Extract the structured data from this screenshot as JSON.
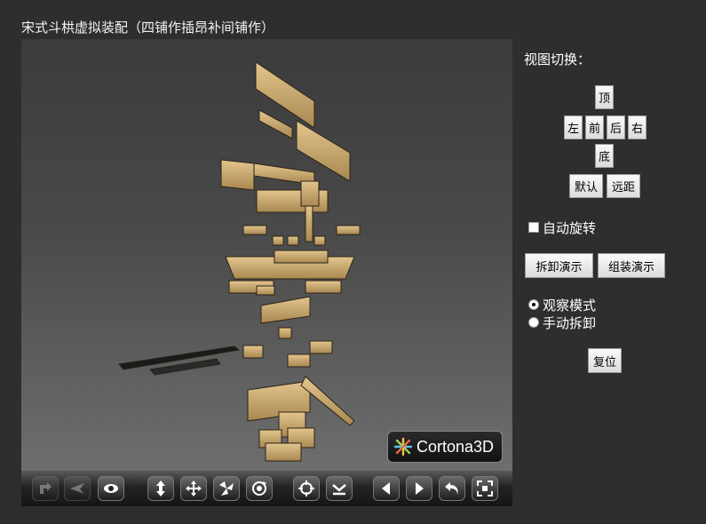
{
  "title": "宋式斗栱虚拟装配（四铺作插昂补间铺作）",
  "viewport": {
    "logo_text": "Cortona3D",
    "toolbar": [
      {
        "name": "plan-icon"
      },
      {
        "name": "fly-icon"
      },
      {
        "name": "eye-icon"
      },
      {
        "name": "vertical-move-icon"
      },
      {
        "name": "pan-icon"
      },
      {
        "name": "rotate-icon"
      },
      {
        "name": "orbit-icon"
      },
      {
        "name": "target-icon"
      },
      {
        "name": "align-icon"
      },
      {
        "name": "prev-icon"
      },
      {
        "name": "next-icon"
      },
      {
        "name": "undo-icon"
      },
      {
        "name": "fit-icon"
      }
    ]
  },
  "panel": {
    "view_switch_label": "视图切换：",
    "views": {
      "top": "顶",
      "left": "左",
      "front": "前",
      "back": "后",
      "right": "右",
      "bottom": "底",
      "default": "默认",
      "far": "远距"
    },
    "auto_rotate_label": "自动旋转",
    "auto_rotate_checked": false,
    "disassemble_demo": "拆卸演示",
    "assemble_demo": "组装演示",
    "mode_observe": "观察模式",
    "mode_manual": "手动拆卸",
    "selected_mode": "观察模式",
    "reset": "复位"
  },
  "colors": {
    "background": "#2e2e2e",
    "wood": "#c8a66c",
    "wood_dark": "#8a6d3d"
  }
}
